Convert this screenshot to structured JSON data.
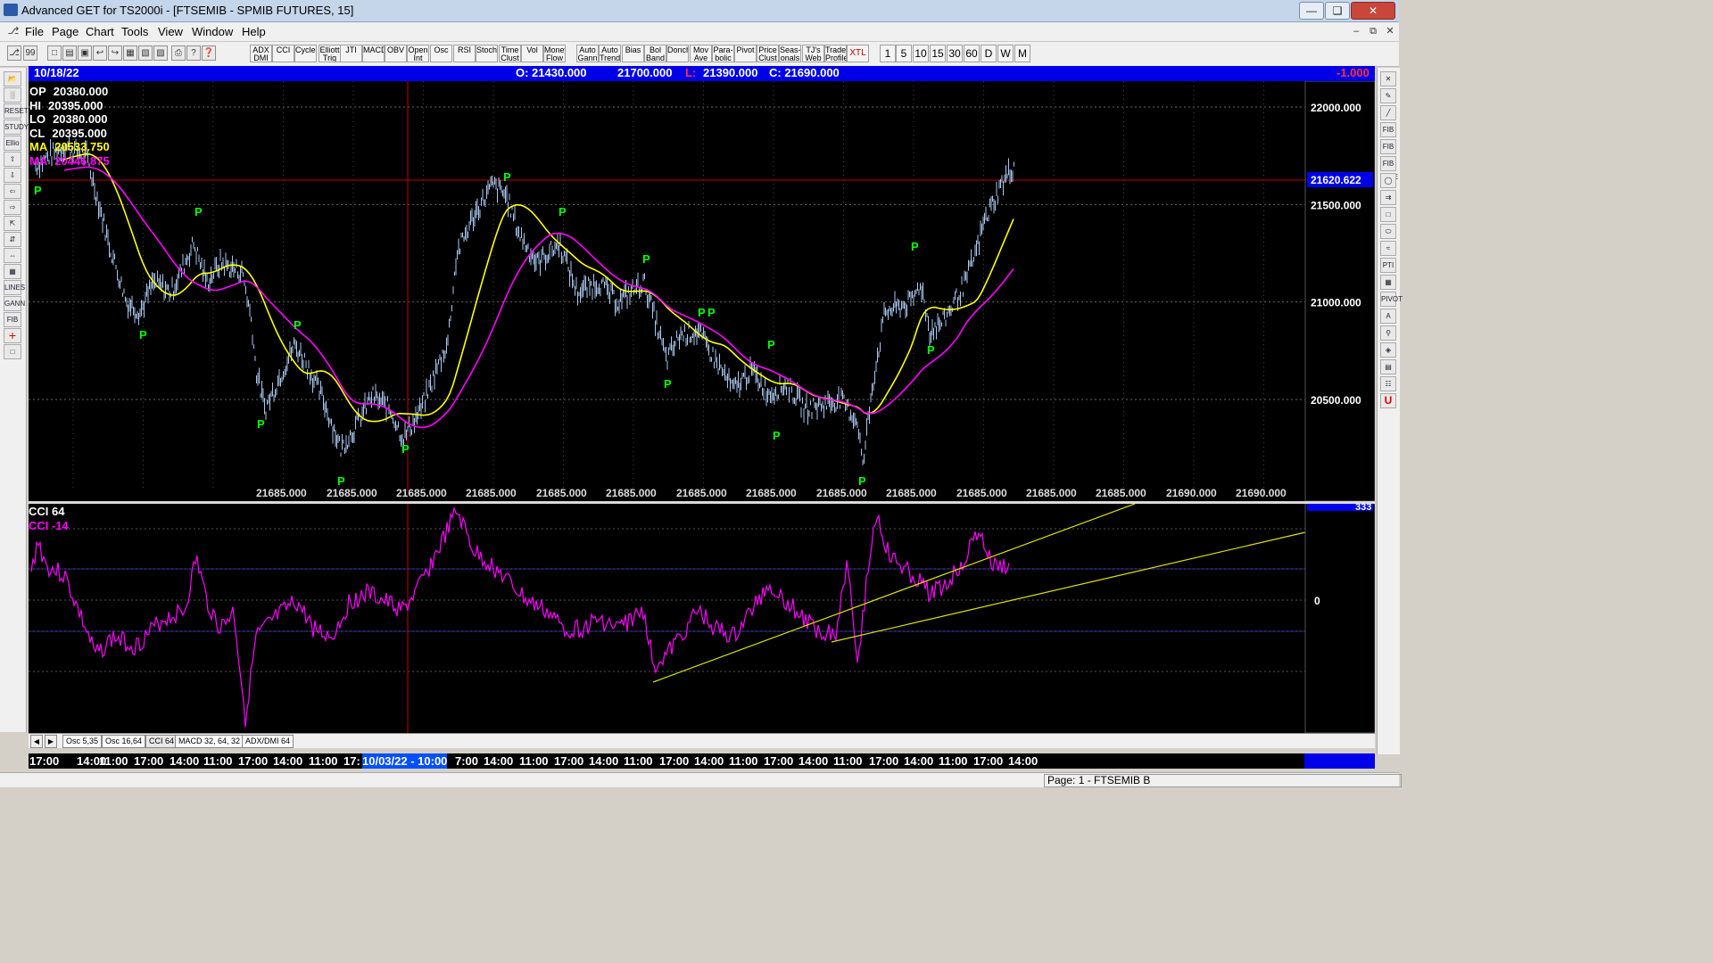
{
  "window": {
    "title": "Advanced GET for TS2000i - [FTSEMIB - SPMIB FUTURES, 15]"
  },
  "menu": [
    "File",
    "Page",
    "Chart",
    "Tools",
    "View",
    "Window",
    "Help"
  ],
  "toolbar": {
    "indicators": [
      "ADX DMI",
      "CCI",
      "Cycles",
      "Elliott Trig",
      "JTI",
      "MACD",
      "OBV",
      "Open Int",
      "Osc",
      "RSI",
      "Stoch",
      "Time Clust",
      "Vol",
      "Money Flow",
      "Auto Gann",
      "Auto Trend",
      "Bias",
      "Bol Band",
      "Donch",
      "Mov Ave",
      "Para- bolic",
      "Pivot",
      "Price Clust",
      "Seas- onals",
      "TJ's Web",
      "Trade Profile",
      "XTL"
    ],
    "periods": [
      "1",
      "5",
      "10",
      "15",
      "30",
      "60",
      "D",
      "W",
      "M"
    ]
  },
  "left_toolbar": [
    "open-icon",
    "bar-icon",
    "reset",
    "study",
    "elliott",
    "up-arrow-icon",
    "down-arrow-icon",
    "left-arrow-icon",
    "right-arrow-icon",
    "compress-icon",
    "expand-icon",
    "horizontal-icon",
    "grid-icon",
    "lines",
    "gann",
    "fib",
    "crosshair-icon",
    "copy-icon"
  ],
  "right_toolbar": [
    "close-icon",
    "pencil-icon",
    "line-icon",
    "fib-ret",
    "fib-ext",
    "fib-time",
    "circle-icon",
    "trend-icon",
    "box-icon",
    "ellipse-icon",
    "wave-icon",
    "pti",
    "grid-icon",
    "pivot-icon",
    "text-icon",
    "zoom-icon",
    "paint-icon",
    "calendar-icon",
    "report-icon",
    "u-icon"
  ],
  "chart_header": {
    "date": "10/18/22",
    "open": "O: 21430.000",
    "high": "21700.000",
    "low_label": "L:",
    "low": "21390.000",
    "close": "C: 21690.000",
    "change": "-1.000"
  },
  "data_window": [
    {
      "label": "OP",
      "value": "20380.000",
      "color": "#ffffff"
    },
    {
      "label": "HI",
      "value": "20395.000",
      "color": "#ffffff"
    },
    {
      "label": "LO",
      "value": "20380.000",
      "color": "#ffffff"
    },
    {
      "label": "CL",
      "value": "20395.000",
      "color": "#ffffff"
    },
    {
      "label": "MA",
      "value": "20533.750",
      "color": "#ffff00"
    },
    {
      "label": "MA",
      "value": "20446.875",
      "color": "#ff00ff"
    }
  ],
  "price_axis": {
    "ticks": [
      "22000.000",
      "21500.000",
      "21000.000",
      "20500.000"
    ],
    "current": "21620.622"
  },
  "bottom_price_labels": [
    "21685.000",
    "21685.000",
    "21685.000",
    "21685.000",
    "21685.000",
    "21685.000",
    "21685.000",
    "21685.000",
    "21685.000",
    "21685.000",
    "21685.000",
    "21685.000",
    "21685.000",
    "21690.000",
    "21690.000"
  ],
  "pivot_label": "P",
  "cci": {
    "title": "CCI 64",
    "value_label": "CCI  -14",
    "axis_zero": "0",
    "axis_top": "333"
  },
  "indicator_tabs": [
    "Osc 5,35",
    "Osc 16,64",
    "CCI 64",
    "MACD 32, 64, 32",
    "ADX/DMI 64"
  ],
  "active_tab": "CCI 64",
  "time_axis": [
    "17:00",
    "14:00",
    "11:00",
    "17:00",
    "14:00",
    "11:00",
    "17:00",
    "14:00",
    "11:00",
    "17:",
    "10/03/22 - 10:00",
    "7:00",
    "14:00",
    "11:00",
    "17:00",
    "14:00",
    "11:00",
    "17:00",
    "14:00",
    "11:00",
    "17:00",
    "14:00",
    "11:00",
    "17:00",
    "14:00",
    "11:00",
    "17:00",
    "14:00"
  ],
  "status": {
    "page": "Page: 1 - FTSEMIB B"
  },
  "colors": {
    "header_bg": "#0000e8",
    "ma_fast": "#ffff00",
    "ma_slow": "#ff00ff",
    "price_bars": "#a8c8f0",
    "pivot": "#00ff00",
    "cci_line": "#ff00ff",
    "trend_line": "#e0e000",
    "cursor_line": "#c00000"
  }
}
